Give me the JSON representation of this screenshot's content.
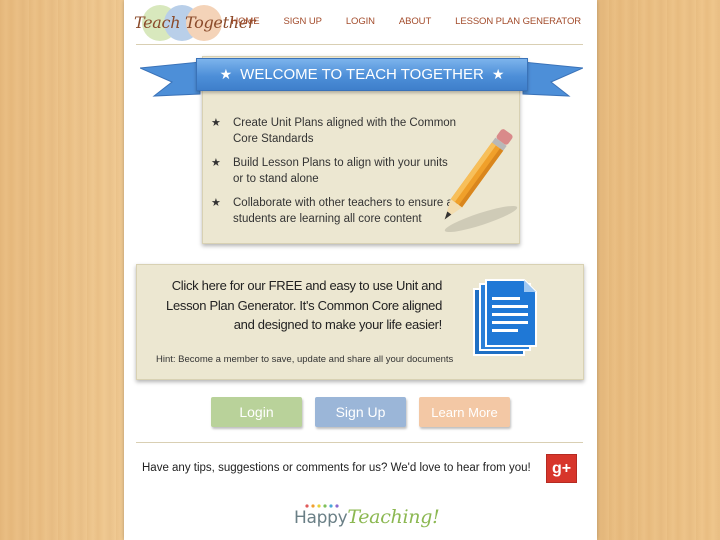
{
  "header": {
    "logo_text": "Teach Together",
    "nav": [
      "HOME",
      "SIGN UP",
      "LOGIN",
      "ABOUT",
      "LESSON PLAN GENERATOR"
    ]
  },
  "welcome": {
    "banner_title": "WELCOME TO TEACH TOGETHER",
    "bullets": [
      "Create Unit Plans aligned with the Common Core Standards",
      "Build Lesson Plans to align with your units or to stand alone",
      "Collaborate with other teachers to ensure all students are learning all core content"
    ]
  },
  "generator": {
    "line1": "Click here for our FREE and easy to use Unit and",
    "line2": "Lesson Plan Generator. It's Common Core aligned",
    "line3": "and designed to make your life easier!",
    "hint": "Hint: Become a member to save, update and share all your documents"
  },
  "buttons": {
    "login": "Login",
    "signup": "Sign Up",
    "learn_more": "Learn More"
  },
  "footer": {
    "tips": "Have any tips, suggestions or comments for us? We'd love to hear from you!",
    "gplus_label": "g+",
    "tagline_a": "Happy",
    "tagline_b": "Teaching!"
  },
  "colors": {
    "nav_text": "#a34c2c",
    "ribbon": "#4d8fd8",
    "panel_bg": "#ece7d1",
    "login_btn": "#b9d29a",
    "signup_btn": "#9bb6d8",
    "learn_btn": "#f3c8a5",
    "gplus": "#d7352b"
  },
  "icons": [
    "star-icon",
    "pencil-icon",
    "document-icon",
    "google-plus-icon"
  ]
}
